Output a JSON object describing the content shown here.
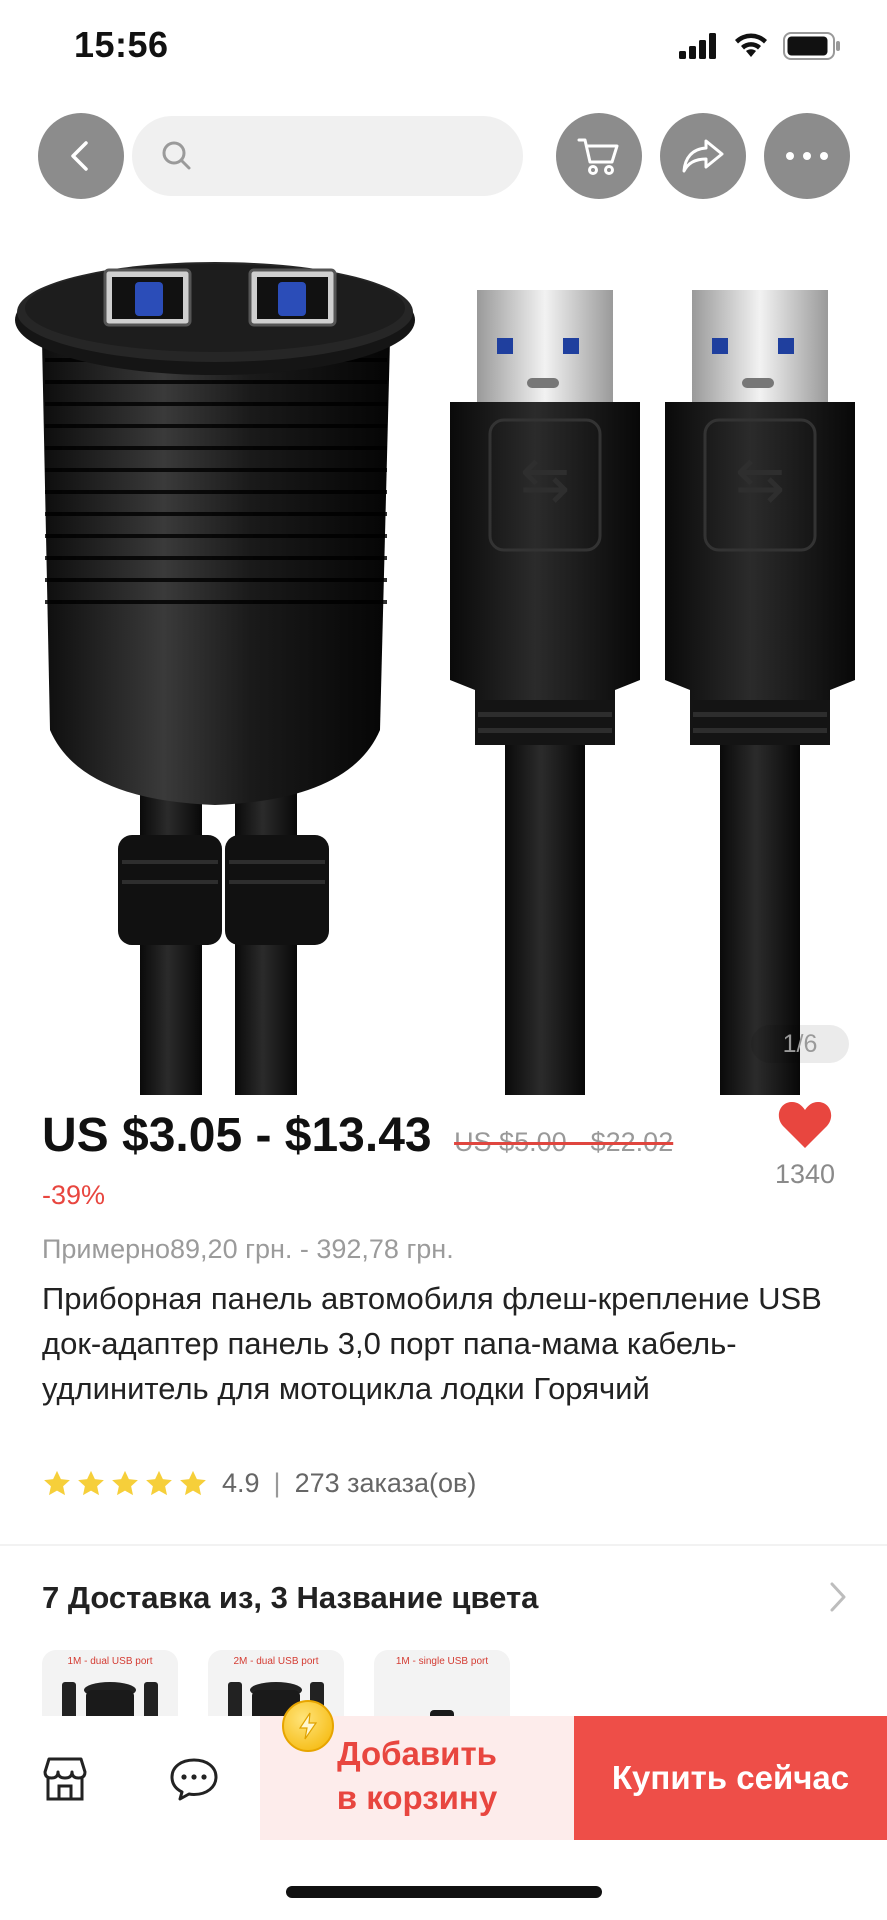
{
  "status_bar": {
    "time": "15:56"
  },
  "search": {
    "placeholder": ""
  },
  "gallery": {
    "counter": "1/6"
  },
  "price": {
    "range": "US $3.05 - $13.43",
    "original": "US $5.00 - $22.02",
    "discount": "-39%",
    "approx": "Примерно89,20 грн. - 392,78 грн."
  },
  "wishlist": {
    "count": "1340"
  },
  "product": {
    "title": "Приборная панель автомобиля флеш-крепление USB док-адаптер панель 3,0 порт папа-мама кабель-удлинитель для мотоцикла лодки Горячий",
    "rating": "4.9",
    "orders": "273 заказа(ов)"
  },
  "shipping": {
    "summary": "7 Доставка из, 3 Название цвета"
  },
  "thumbnails": [
    {
      "label": "1M - dual USB port"
    },
    {
      "label": "2M - dual USB port"
    },
    {
      "label": "1M - single USB port"
    }
  ],
  "actions": {
    "add_to_cart_line1": "Добавить",
    "add_to_cart_line2": "в корзину",
    "buy_now": "Купить сейчас"
  },
  "colors": {
    "accent": "#ee4e48",
    "star": "#f6cf3a",
    "heart": "#e8463f"
  }
}
